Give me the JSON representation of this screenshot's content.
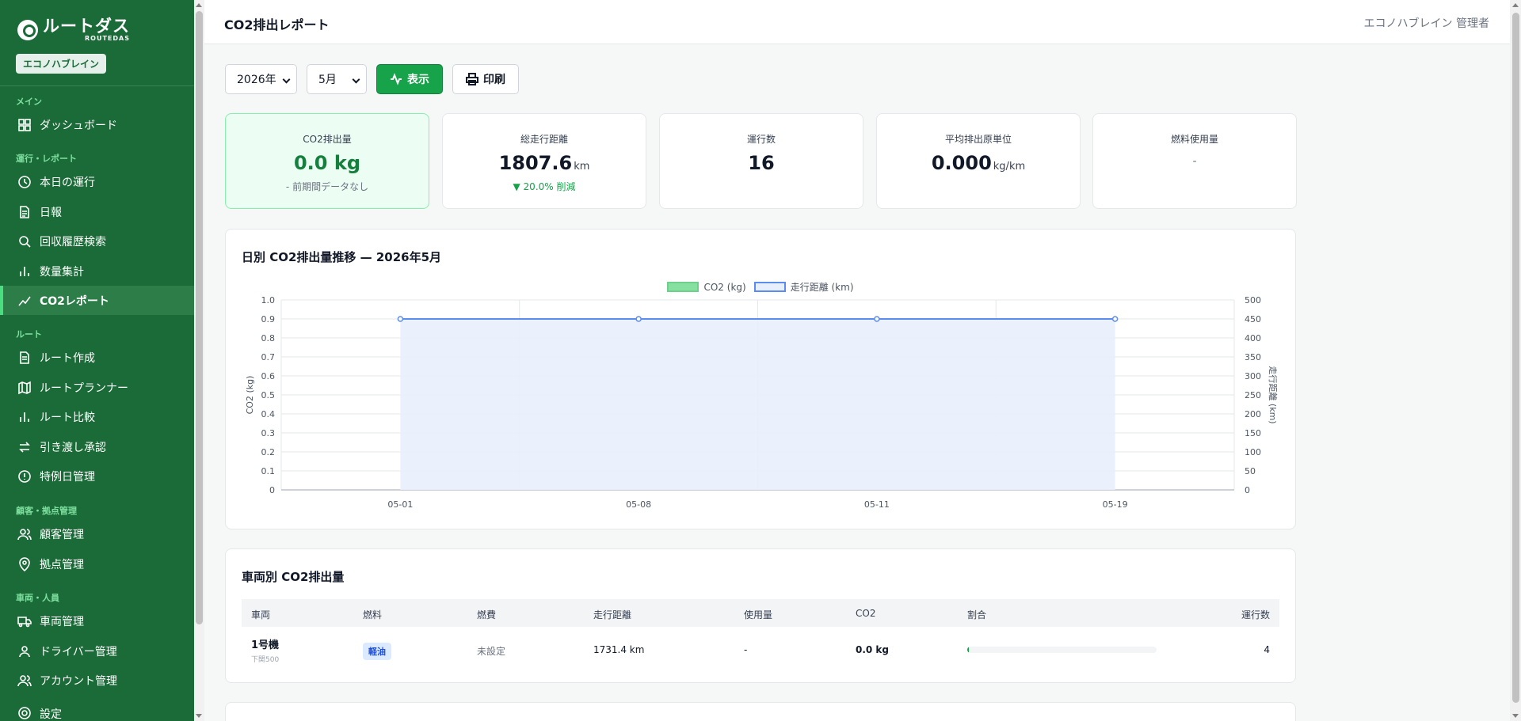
{
  "app": {
    "logo_title": "ルートダス",
    "logo_subtitle": "ROUTEDAS",
    "org_name": "エコノハブレイン"
  },
  "header": {
    "title": "CO2排出レポート",
    "user": "エコノハブレイン 管理者"
  },
  "sidebar": {
    "sections": [
      {
        "label": "メイン",
        "items": [
          {
            "label": "ダッシュボード",
            "icon": "grid-icon"
          }
        ]
      },
      {
        "label": "運行・レポート",
        "items": [
          {
            "label": "本日の運行",
            "icon": "clock-icon"
          },
          {
            "label": "日報",
            "icon": "document-icon"
          },
          {
            "label": "回収履歴検索",
            "icon": "search-icon"
          },
          {
            "label": "数量集計",
            "icon": "bar-chart-icon"
          },
          {
            "label": "CO2レポート",
            "icon": "trend-icon",
            "active": true
          }
        ]
      },
      {
        "label": "ルート",
        "items": [
          {
            "label": "ルート作成",
            "icon": "document-icon"
          },
          {
            "label": "ルートプランナー",
            "icon": "map-icon"
          },
          {
            "label": "ルート比較",
            "icon": "bar-chart-icon"
          },
          {
            "label": "引き渡し承認",
            "icon": "swap-icon"
          },
          {
            "label": "特例日管理",
            "icon": "alert-circle-icon"
          }
        ]
      },
      {
        "label": "顧客・拠点管理",
        "items": [
          {
            "label": "顧客管理",
            "icon": "users-icon"
          },
          {
            "label": "拠点管理",
            "icon": "pin-icon"
          }
        ]
      },
      {
        "label": "車両・人員",
        "items": [
          {
            "label": "車両管理",
            "icon": "truck-icon"
          },
          {
            "label": "ドライバー管理",
            "icon": "user-icon"
          },
          {
            "label": "アカウント管理",
            "icon": "users-icon"
          }
        ]
      }
    ],
    "partial_item": "設定"
  },
  "toolbar": {
    "year": "2026年",
    "month": "5月",
    "show_label": "表示",
    "print_label": "印刷"
  },
  "kpis": [
    {
      "label": "CO2排出量",
      "value": "0.0",
      "unit": "kg",
      "sub": "- 前期間データなし"
    },
    {
      "label": "総走行距離",
      "value": "1807.6",
      "unit": "km",
      "sub": "▼ 20.0% 削減"
    },
    {
      "label": "運行数",
      "value": "16",
      "unit": "",
      "sub": ""
    },
    {
      "label": "平均排出原単位",
      "value": "0.000",
      "unit": "kg/km",
      "sub": ""
    },
    {
      "label": "燃料使用量",
      "value": "-",
      "unit": "",
      "sub": ""
    }
  ],
  "chart_panel": {
    "title": "日別 CO2排出量推移 — 2026年5月"
  },
  "chart_data": {
    "type": "line",
    "categories": [
      "05-01",
      "05-08",
      "05-11",
      "05-19"
    ],
    "series": [
      {
        "name": "CO2 (kg)",
        "axis": "left",
        "values": [
          0,
          0,
          0,
          0
        ],
        "color": "#86e0a0"
      },
      {
        "name": "走行距離 (km)",
        "axis": "right",
        "values": [
          450,
          450,
          450,
          450
        ],
        "color": "#5b8def"
      }
    ],
    "ylabel": "CO2 (kg)",
    "y2label": "走行距離 (km)",
    "ylim": [
      0,
      1.0
    ],
    "y2lim": [
      0,
      500
    ],
    "yticks": [
      "0",
      "0.1",
      "0.2",
      "0.3",
      "0.4",
      "0.5",
      "0.6",
      "0.7",
      "0.8",
      "0.9",
      "1.0"
    ],
    "y2ticks": [
      "0",
      "50",
      "100",
      "150",
      "200",
      "250",
      "300",
      "350",
      "400",
      "450",
      "500"
    ],
    "legend_position": "top-center",
    "grid": true
  },
  "vehicle_panel": {
    "title": "車両別 CO2排出量",
    "columns": [
      "車両",
      "燃料",
      "燃費",
      "走行距離",
      "使用量",
      "CO2",
      "割合",
      "運行数"
    ],
    "rows": [
      {
        "vehicle": "1号機",
        "plate": "下関500",
        "fuel": "軽油",
        "efficiency": "未設定",
        "distance": "1731.4 km",
        "usage": "-",
        "co2": "0.0 kg",
        "share": 0.01,
        "trips": "4"
      }
    ]
  }
}
